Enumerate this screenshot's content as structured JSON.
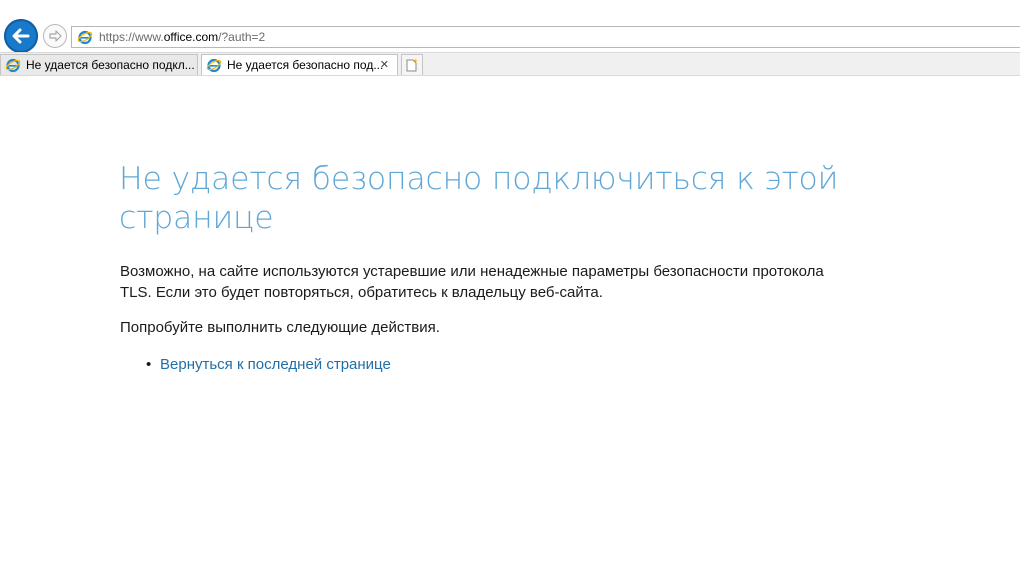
{
  "browser": {
    "address": {
      "prefix": "https://www.",
      "domain": "office.com",
      "suffix": "/?auth=2"
    },
    "tabs": [
      {
        "title": "Не удается безопасно подкл...",
        "active": false
      },
      {
        "title": "Не удается безопасно под...",
        "active": true,
        "close": "✕"
      }
    ],
    "icons": {
      "back": "back-arrow-icon",
      "forward": "forward-arrow-icon",
      "ie": "internet-explorer-icon",
      "new_tab": "new-tab-icon"
    },
    "colors": {
      "back_button": "#1979ca",
      "heading": "#5fa7d6",
      "link": "#1f6fa8"
    }
  },
  "page": {
    "heading": "Не удается безопасно подключиться к этой странице",
    "body": "Возможно, на сайте используются устаревшие или ненадежные параметры безопасности протокола TLS. Если это будет повторяться, обратитесь к владельцу веб-сайта.",
    "suggestion": "Попробуйте выполнить следующие действия.",
    "actions": [
      {
        "bullet": "•",
        "label": "Вернуться к последней странице"
      }
    ]
  }
}
